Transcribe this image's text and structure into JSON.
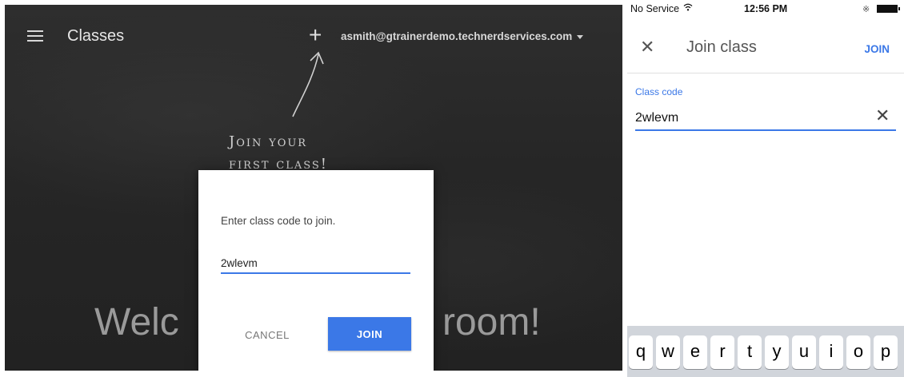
{
  "desktop": {
    "app_title": "Classes",
    "account_email": "asmith@gtrainerdemo.technerdservices.com",
    "hint_line1": "Join your",
    "hint_line2": "first class!",
    "welcome_left": "Welc",
    "welcome_right": "room!",
    "dialog": {
      "prompt": "Enter class code to join.",
      "code_value": "2wlevm",
      "cancel_label": "CANCEL",
      "join_label": "JOIN"
    }
  },
  "phone": {
    "status": {
      "carrier": "No Service",
      "time": "12:56 PM"
    },
    "toolbar": {
      "title": "Join class",
      "join_label": "JOIN"
    },
    "field": {
      "label": "Class code",
      "value": "2wlevm"
    },
    "keyboard_row": [
      "q",
      "w",
      "e",
      "r",
      "t",
      "y",
      "u",
      "i",
      "o",
      "p"
    ]
  },
  "colors": {
    "accent": "#3b78e7",
    "chalkboard": "#262626"
  },
  "icons": {
    "menu": "menu-icon",
    "add": "add-icon",
    "close": "close-icon",
    "clear": "clear-icon",
    "wifi": "wifi-icon",
    "bluetooth": "bluetooth-icon",
    "battery": "battery-icon"
  }
}
